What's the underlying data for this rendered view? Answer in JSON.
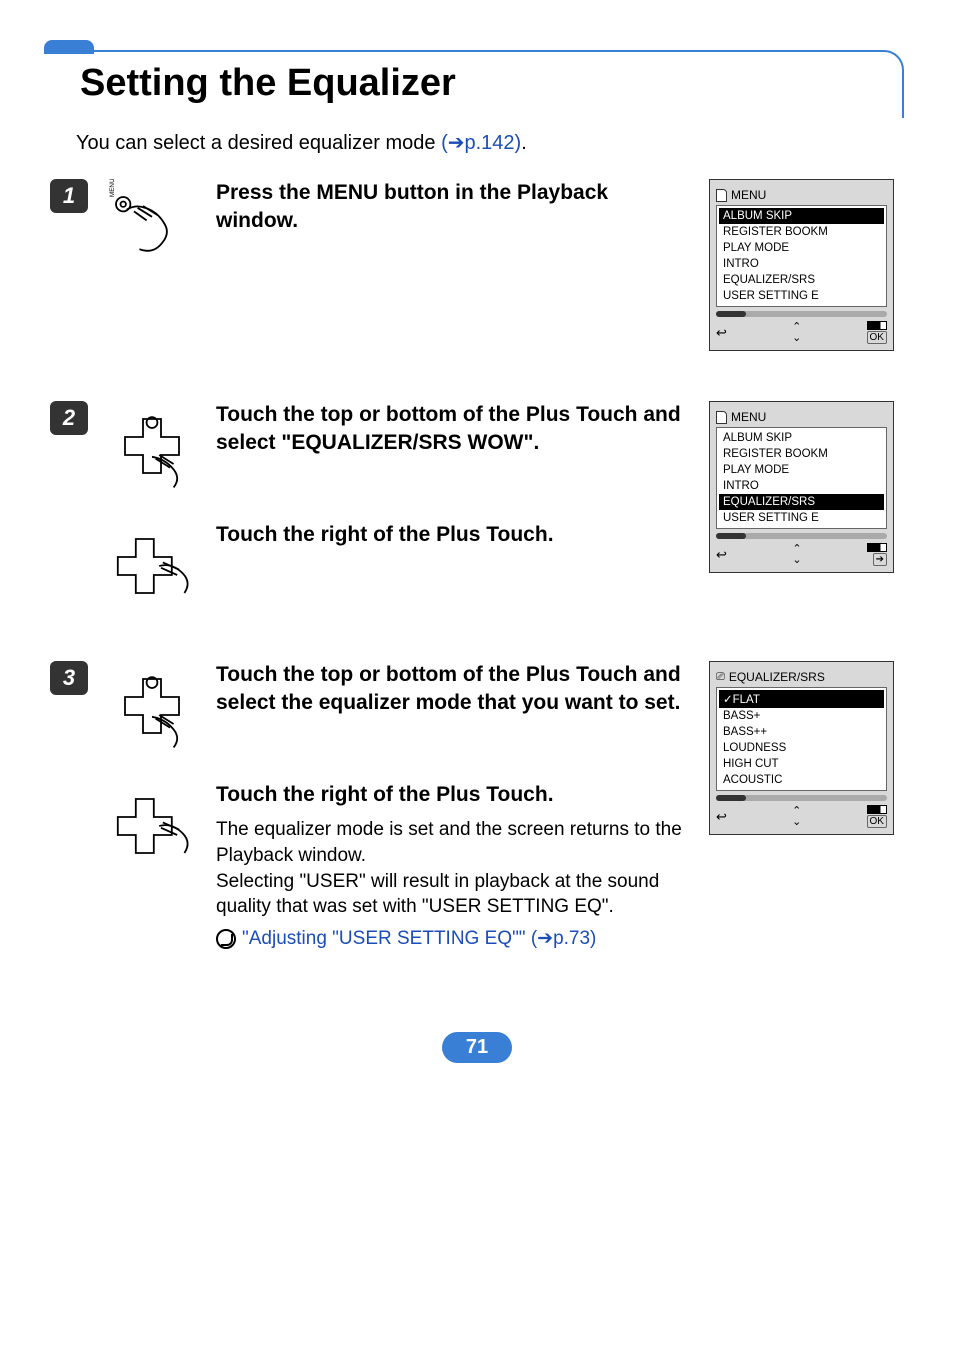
{
  "title": "Setting the Equalizer",
  "intro_prefix": "You can select a desired equalizer mode ",
  "intro_link": "(➔p.142)",
  "intro_suffix": ".",
  "steps": {
    "s1": {
      "num": "1",
      "inst": "Press the MENU button in the Playback window.",
      "screen": {
        "title": "MENU",
        "items": [
          "ALBUM SKIP",
          "REGISTER BOOKM",
          "PLAY MODE",
          "INTRO",
          "EQUALIZER/SRS",
          "USER SETTING E"
        ],
        "selected": 0,
        "foot_right": "OK"
      }
    },
    "s2": {
      "num": "2",
      "inst_a": "Touch the top or bottom of the Plus Touch and select \"EQUALIZER/SRS WOW\".",
      "inst_b": "Touch the right of the Plus Touch.",
      "screen": {
        "title": "MENU",
        "items": [
          "ALBUM SKIP",
          "REGISTER BOOKM",
          "PLAY MODE",
          "INTRO",
          "EQUALIZER/SRS",
          "USER SETTING E"
        ],
        "selected": 4,
        "foot_right": "➔"
      }
    },
    "s3": {
      "num": "3",
      "inst_a": "Touch the top or bottom of the Plus Touch and select the equalizer mode that you want to set.",
      "inst_b": "Touch the right of the Plus Touch.",
      "body1": "The equalizer mode is set and the screen returns to the Playback window.",
      "body2": "Selecting \"USER\" will result in playback at the sound quality that was set with \"USER SETTING EQ\".",
      "link": "\"Adjusting \"USER SETTING EQ\"\" (➔p.73)",
      "screen": {
        "title": "EQUALIZER/SRS",
        "items": [
          "FLAT",
          "BASS+",
          "BASS++",
          "LOUDNESS",
          "HIGH CUT",
          "ACOUSTIC"
        ],
        "selected": 0,
        "checked": 0,
        "foot_right": "OK"
      }
    }
  },
  "page_number": "71",
  "chart_data": null
}
